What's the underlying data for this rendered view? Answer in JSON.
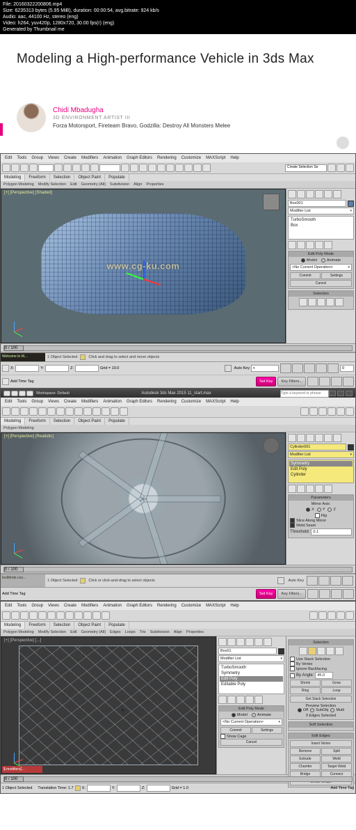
{
  "meta": {
    "l1": "File: 20160322200806.mp4",
    "l2": "Size: 6235313 bytes (5.95 MiB), duration: 00:00:54, avg.bitrate: 924 kb/s",
    "l3": "Audio: aac, 44100 Hz, stereo (eng)",
    "l4": "Video: h264, yuv420p, 1280x720, 30.00 fps(r) (eng)",
    "l5": "Generated by Thumbnail me"
  },
  "course": {
    "title": "Modeling a High-performance Vehicle in 3ds Max",
    "author": "Chidi Mbadugha",
    "role": "3D ENVIRONMENT ARTIST III",
    "credits": "Forza Motorsport, Fireteam Bravo, Godzilla: Destroy All Monsters Melee"
  },
  "watermark": "www.cg-ku.com",
  "menus": [
    "Edit",
    "Tools",
    "Group",
    "Views",
    "Create",
    "Modifiers",
    "Animation",
    "Graph Editors",
    "Rendering",
    "Customize",
    "MAXScript",
    "Help"
  ],
  "ribbonTabs": [
    "Modeling",
    "Freeform",
    "Selection",
    "Object Paint",
    "Populate"
  ],
  "ribbonSub": [
    "Polygon Modeling",
    "Modify Selection",
    "Edit",
    "Geometry (All)",
    "Subdivision",
    "Align",
    "Properties"
  ],
  "ribbonSub3": [
    "Polygon Modeling",
    "Modify Selection",
    "Edit",
    "Geometry (All)",
    "Edges",
    "Loops",
    "Tris",
    "Subdivision",
    "Align",
    "Properties"
  ],
  "app1": {
    "title": "",
    "viewLabel": "[+] [Perspective] [Shaded]",
    "obj": "Box001",
    "modDrop": "Modifier List",
    "mods": [
      "TurboSmooth",
      "Box"
    ],
    "editPolyHdr": "Edit Poly Mode",
    "model": "Model",
    "animate": "Animate",
    "noOp": "<No Current Operation>",
    "commit": "Commit",
    "settings": "Settings",
    "cancel": "Cancel",
    "selHdr": "Selection",
    "status": {
      "sel": "1 Object Selected",
      "hint": "Click and drag to select and move objects",
      "x": "X:",
      "y": "Y:",
      "z": "Z:",
      "grid": "Grid = 10.0",
      "tag": "Add Time Tag",
      "autokey": "Auto Key",
      "setkey": "Set Key",
      "keyf": "Key Filters..."
    },
    "welcome": "Welcome to M...",
    "frame": "0 / 100",
    "pos": "0"
  },
  "app2": {
    "title": "Autodesk 3ds Max 2015   11_start.max",
    "search": "Type a keyword or phrase",
    "workspace": "Workspace: Default",
    "viewLabel": "[+] [Perspective] [Realistic]",
    "obj": "Cylinder001",
    "modDrop": "Modifier List",
    "mods": [
      "Symmetry",
      "Edit Poly",
      "Cylinder"
    ],
    "paramHdr": "Parameters",
    "mirror": "Mirror Axis:",
    "ax": "X",
    "ay": "Y",
    "az": "Z",
    "flip": "Flip",
    "slice": "Slice Along Mirror",
    "weld": "Weld Seam",
    "thresh": "Threshold:",
    "thv": "0.1",
    "status": {
      "sel": "1 Object Selected",
      "hint": "Click or click-and-drag to select objects",
      "tag": "Add Time Tag"
    },
    "toolmode": "toolMode.coo...",
    "frame": "0 / 100",
    "pos": "0"
  },
  "app3": {
    "viewLabel": "[+] [Perspective] [...]",
    "obj": "Box01",
    "modDrop": "Modifier List",
    "mods": [
      "TurboSmooth",
      "Symmetry",
      "Edit Poly",
      "Editable Poly"
    ],
    "editPolyHdr": "Edit Poly Mode",
    "model": "Model",
    "animate": "Animate",
    "noOp": "<No Current Operation>",
    "commit": "Commit",
    "settings": "Settings",
    "showCage": "Show Cage",
    "cancel": "Cancel",
    "selHdr": "Selection",
    "useStack": "Use Stack Selection",
    "byVertex": "By Vertex",
    "ignoreBack": "Ignore Backfacing",
    "byAngle": "By Angle:",
    "angVal": "45.0",
    "shrink": "Shrink",
    "grow": "Grow",
    "ring": "Ring",
    "loop": "Loop",
    "getStack": "Get Stack Selection",
    "prevHdr": "Preview Selection",
    "off": "Off",
    "subObj": "SubObj",
    "multi": "Multi",
    "edgesSel": "0 Edges Selected",
    "softHdr": "Soft Selection",
    "editEdgesHdr": "Edit Edges",
    "insertV": "Insert Vertex",
    "remove": "Remove",
    "split": "Split",
    "extrude": "Extrude",
    "weld": "Weld",
    "chamfer": "Chamfer",
    "targetW": "Target Weld",
    "bridge": "Bridge",
    "connect": "Connect",
    "createShape": "Create Shape",
    "status": {
      "sel": "1 Object Selected",
      "frame": "Translation Time: 1.7",
      "x": "X:",
      "y": "Y:",
      "z": "Z:",
      "grid": "Grid = 1.0",
      "tag": "Add Time Tag"
    },
    "toolmode": "$.modifiers[...",
    "frame": "0 / 100",
    "pos": "0"
  }
}
